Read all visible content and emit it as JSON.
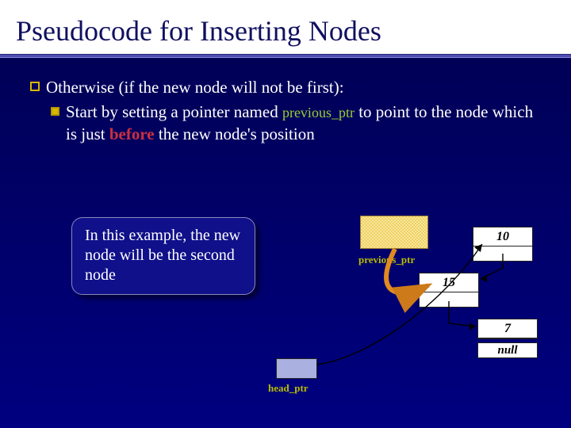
{
  "title": "Pseudocode for Inserting Nodes",
  "bullets": {
    "main": "Otherwise (if the new node will not be first):",
    "sub_pre": "Start by setting a pointer named ",
    "sub_code": "previous_ptr",
    "sub_mid": " to point to the node which is just ",
    "sub_before": "before",
    "sub_post": " the new node's position"
  },
  "callout": "In this example, the new node will be the second node",
  "labels": {
    "previous_ptr": "previous_ptr",
    "head_ptr": "head_ptr"
  },
  "nodes": {
    "n10": "10",
    "n15": "15",
    "n7": "7",
    "null": "null"
  }
}
